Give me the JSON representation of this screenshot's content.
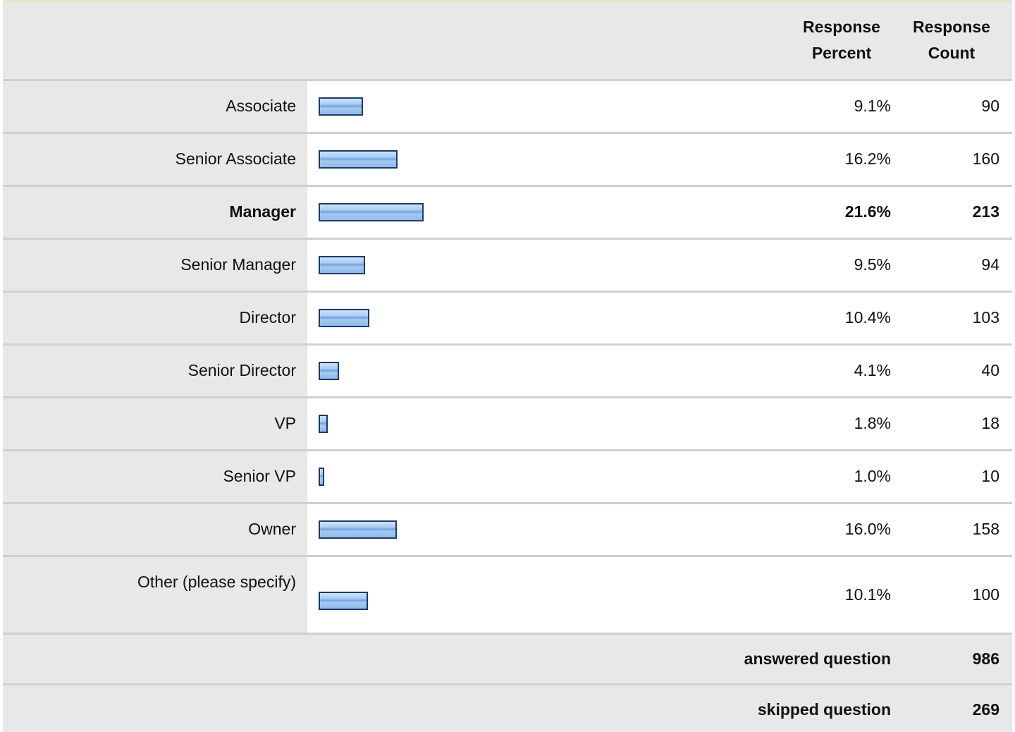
{
  "chart_data": {
    "type": "bar",
    "orientation": "horizontal",
    "columns": [
      "Response Percent",
      "Response Count"
    ],
    "categories": [
      "Associate",
      "Senior Associate",
      "Manager",
      "Senior Manager",
      "Director",
      "Senior Director",
      "VP",
      "Senior VP",
      "Owner",
      "Other (please specify)"
    ],
    "percent_labels": [
      "9.1%",
      "16.2%",
      "21.6%",
      "9.5%",
      "10.4%",
      "4.1%",
      "1.8%",
      "1.0%",
      "16.0%",
      "10.1%"
    ],
    "values": [
      9.1,
      16.2,
      21.6,
      9.5,
      10.4,
      4.1,
      1.8,
      1.0,
      16.0,
      10.1
    ],
    "counts": [
      "90",
      "160",
      "213",
      "94",
      "103",
      "40",
      "18",
      "10",
      "158",
      "100"
    ],
    "highlighted_category": "Manager",
    "bar_color": "#8ebcea",
    "bar_border_color": "#1d3b66"
  },
  "header": {
    "percent_line1": "Response",
    "percent_line2": "Percent",
    "count_line1": "Response",
    "count_line2": "Count"
  },
  "footer": {
    "answered_label": "answered question",
    "answered_value": "986",
    "skipped_label": "skipped question",
    "skipped_value": "269"
  }
}
